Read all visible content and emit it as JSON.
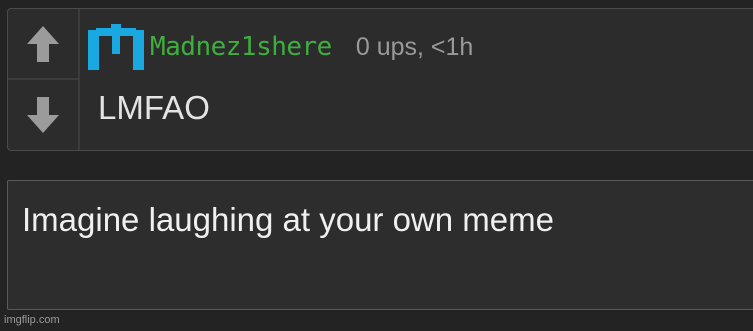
{
  "comment": {
    "username": "Madnez1shere",
    "stats": "0 ups, <1h",
    "text": "LMFAO",
    "avatar_icon": "stickman-avatar-icon",
    "avatar_color": "#19a9e0",
    "username_color": "#3fae3f",
    "upvote_icon": "arrow-up-icon",
    "downvote_icon": "arrow-down-icon"
  },
  "reply": {
    "value": "Imagine laughing at your own meme"
  },
  "watermark": "imgflip.com"
}
